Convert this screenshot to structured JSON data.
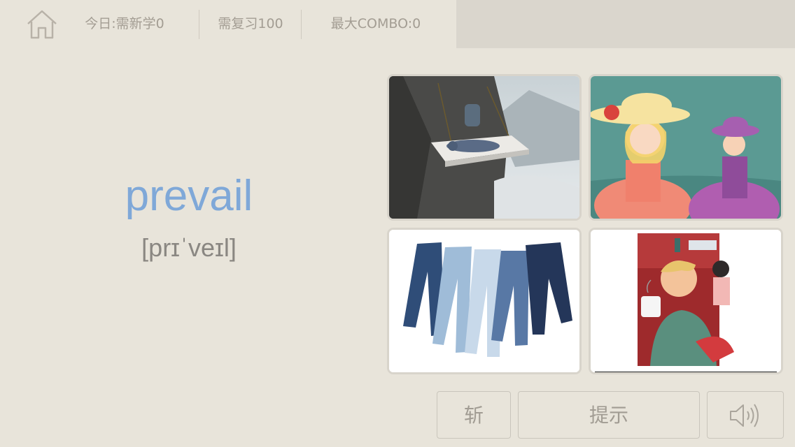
{
  "header": {
    "today_new": "今日:需新学0",
    "review": "需复习100",
    "max_combo": "最大COMBO:0"
  },
  "word": {
    "text": "prevail",
    "phonetic": "[prɪˈveɪl]"
  },
  "options": [
    {
      "image": "cliff-bed-photo"
    },
    {
      "image": "two-ladies-chatting-illustration"
    },
    {
      "image": "jeans-photo"
    },
    {
      "image": "man-with-coffee-cafe-illustration"
    }
  ],
  "buttons": {
    "kill": "斩",
    "hint": "提示",
    "audio_icon": "speaker-icon"
  },
  "colors": {
    "background": "#e8e4da",
    "word": "#7fa8d8",
    "muted_text": "#a39d93"
  }
}
